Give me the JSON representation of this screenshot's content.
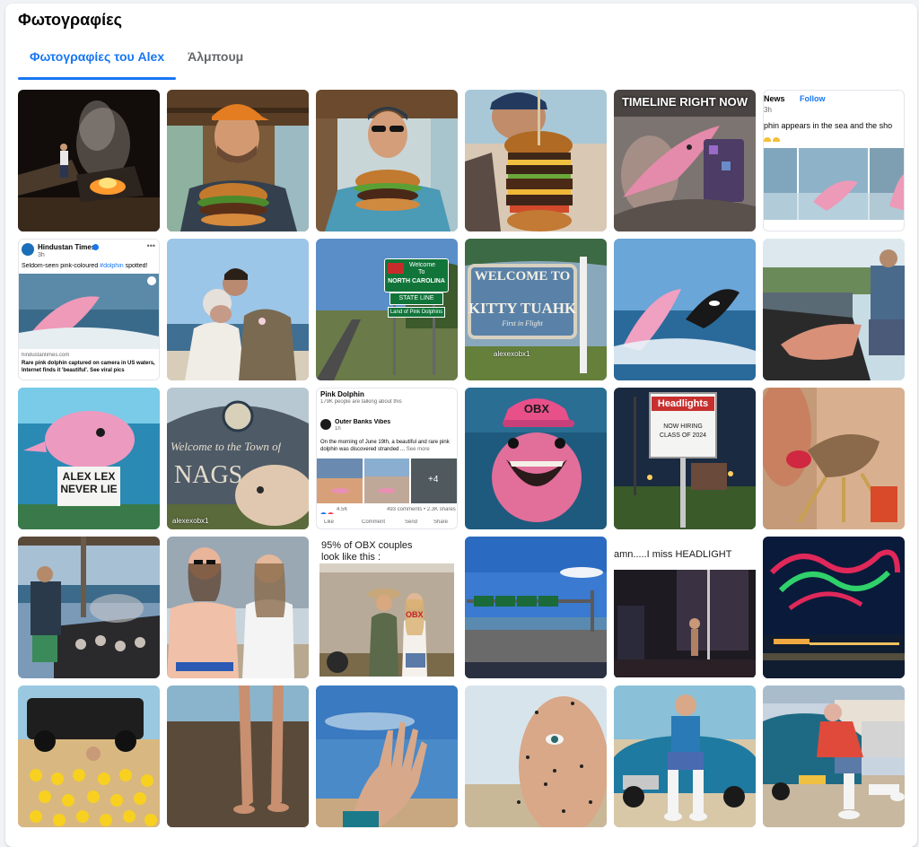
{
  "header": {
    "title": "Φωτογραφίες"
  },
  "tabs": [
    {
      "label": "Φωτογραφίες του Alex",
      "active": true
    },
    {
      "label": "Άλμπουμ",
      "active": false
    }
  ],
  "colors": {
    "accent": "#1877f2",
    "text": "#050505",
    "muted": "#65676b"
  },
  "photos": {
    "p5": {
      "headline": "TIMELINE RIGHT NOW"
    },
    "p6": {
      "source": "News",
      "follow": "Follow",
      "age": "3h",
      "text": "phin appears in the sea and the sho"
    },
    "p7": {
      "source": "Hindustan Times",
      "age": "3h",
      "post_pre": "Seldom-seen pink-coloured ",
      "hashtag": "#dolphin",
      "post_post": " spotted!",
      "domain": "hindustantimes.com",
      "headline": "Rare pink dolphin captured on camera in US waters, Internet finds it 'beautiful'. See viral pics"
    },
    "p9": {
      "sign1": "Welcome",
      "sign2": "To",
      "sign3": "NORTH CAROLINA",
      "sign4": "STATE LINE",
      "sign5": "Land of Pink Dolphins"
    },
    "p10": {
      "line1": "WELCOME TO",
      "line2": "KITTY TUAHK",
      "line3": "First in Flight",
      "watermark": "alexexobx1"
    },
    "p13": {
      "sign": "ALEX LEX NEVER LIE"
    },
    "p14": {
      "line1": "Welcome to the Town of",
      "line2": "NAGS",
      "watermark": "alexexobx1"
    },
    "p15": {
      "group": "Pink Dolphin",
      "meta": "179K people are talking about this",
      "page": "Outer Banks Vibes",
      "age": "1h",
      "post": "On the morning of June 19th, a beautiful and rare pink dolphin was discovered stranded ...",
      "see_more": "See more",
      "plus": "+4",
      "reactions": "4.5K",
      "stats": "493 comments • 2.3K shares",
      "actions": [
        "Like",
        "Comment",
        "Send",
        "Share"
      ]
    },
    "p16": {
      "cap": "OBX"
    },
    "p17": {
      "line1": "Headlights",
      "line2": "NOW HIRING",
      "line3": "CLASS OF 2024"
    },
    "p21": {
      "caption1": "95% of OBX couples",
      "caption2": "look like this :",
      "shirt": "OBX"
    },
    "p23": {
      "caption": "amn.....I miss HEADLIGHT"
    }
  }
}
